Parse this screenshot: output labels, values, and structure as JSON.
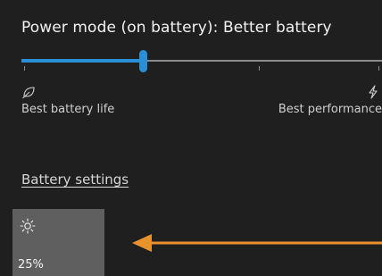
{
  "power_mode": {
    "title": "Power mode (on battery): Better battery",
    "slider_level_percent": 33,
    "left_label": "Best battery life",
    "right_label": "Best performance",
    "left_icon": "leaf-icon",
    "right_icon": "lightning-icon"
  },
  "battery_settings_link": "Battery settings",
  "brightness_tile": {
    "icon": "sun-icon",
    "value": "25%"
  },
  "annotation": {
    "icon": "arrow-left-icon",
    "color": "#e8922b"
  },
  "colors": {
    "accent": "#2b8fd8",
    "background": "#1f1f1f",
    "tile": "#5f5f5f"
  }
}
